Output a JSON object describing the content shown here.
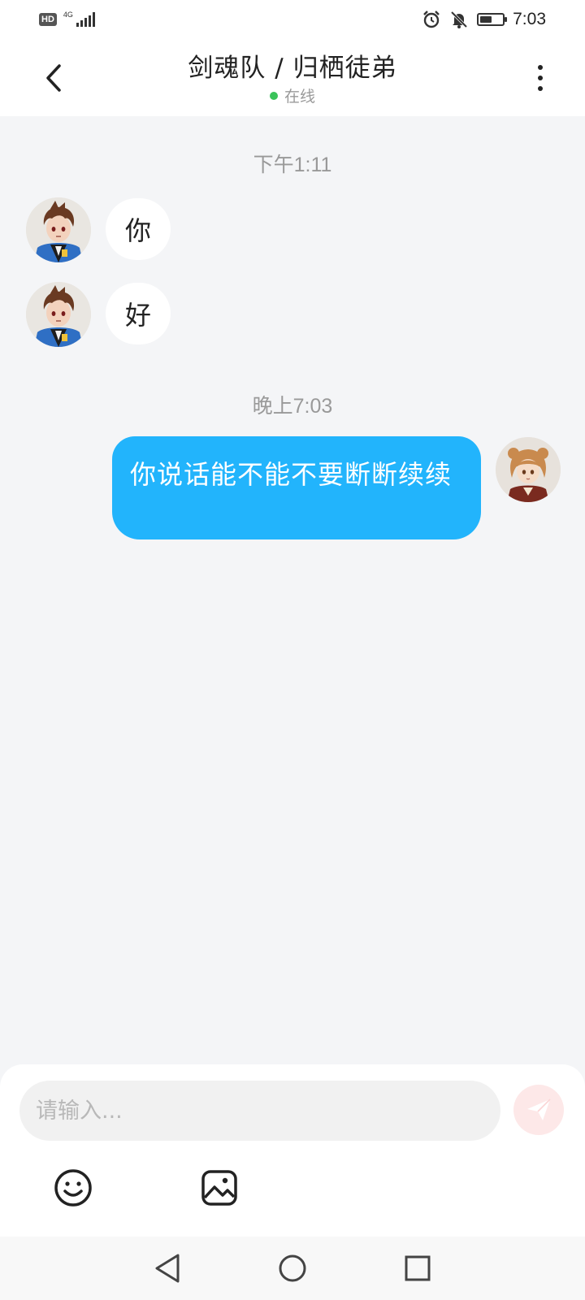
{
  "status_bar": {
    "hd_label": "HD",
    "network_label": "4G",
    "time": "7:03",
    "icons": [
      "hd-icon",
      "signal-icon",
      "alarm-icon",
      "bell-muted-icon",
      "battery-icon"
    ]
  },
  "header": {
    "title": "剑魂队 / 归栖徒弟",
    "status": "在线",
    "status_color": "#3ac35a",
    "back_icon": "chevron-left-icon",
    "more_icon": "more-vertical-icon"
  },
  "messages": [
    {
      "type": "time",
      "text": "下午1:11"
    },
    {
      "type": "received",
      "text": "你",
      "avatar": "male-anime-avatar"
    },
    {
      "type": "received",
      "text": "好",
      "avatar": "male-anime-avatar"
    },
    {
      "type": "time",
      "text": "晚上7:03"
    },
    {
      "type": "sent",
      "text": "你说话能不能不要断断续续",
      "avatar": "female-anime-avatar"
    }
  ],
  "input": {
    "placeholder": "请输入...",
    "send_icon": "send-icon",
    "tools": [
      "emoji-icon",
      "image-icon"
    ]
  },
  "colors": {
    "sent_bubble": "#22b4fc",
    "chat_bg": "#f4f5f7"
  },
  "nav_bar": {
    "buttons": [
      "back-triangle-icon",
      "home-circle-icon",
      "recents-square-icon"
    ]
  }
}
